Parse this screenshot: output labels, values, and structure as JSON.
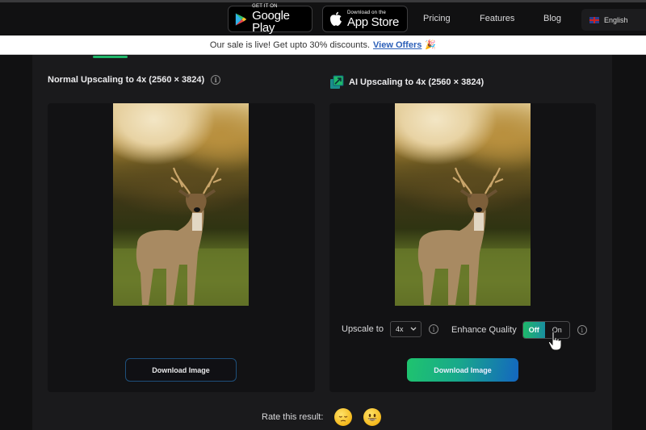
{
  "nav": {
    "google_play": {
      "small": "GET IT ON",
      "big": "Google Play"
    },
    "app_store": {
      "small": "Download on the",
      "big": "App Store"
    },
    "links": [
      "Pricing",
      "Features",
      "Blog"
    ],
    "language": "English"
  },
  "banner": {
    "text": "Our sale is live! Get upto 30% discounts.",
    "link": "View Offers",
    "emoji": "🎉"
  },
  "left": {
    "title": "Normal Upscaling to 4x (2560 × 3824)",
    "download_label": "Download Image"
  },
  "right": {
    "title": "AI Upscaling to 4x (2560 × 3824)",
    "upscale_label": "Upscale to",
    "upscale_value": "4x",
    "enhance_label": "Enhance Quality",
    "toggle_off": "Off",
    "toggle_on": "On",
    "toggle_state": "Off",
    "download_label": "Download Image"
  },
  "rating": {
    "label": "Rate this result:",
    "options": [
      "sad",
      "happy"
    ]
  },
  "colors": {
    "accent_green": "#1fb86a",
    "accent_blue": "#1466c0",
    "link_blue": "#2b5fb8"
  }
}
